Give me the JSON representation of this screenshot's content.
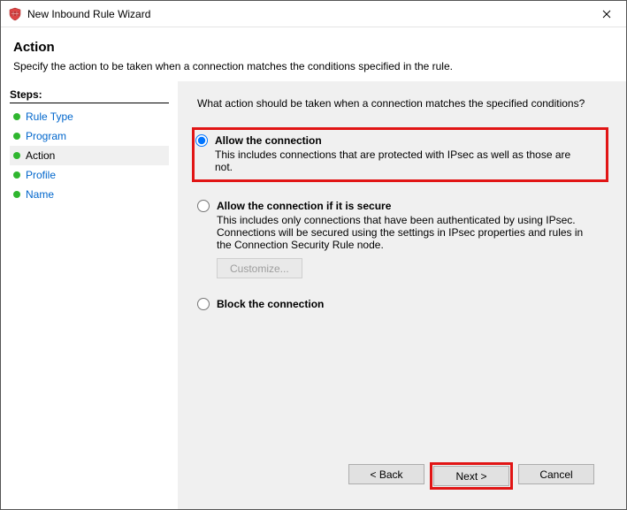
{
  "titlebar": {
    "title": "New Inbound Rule Wizard"
  },
  "header": {
    "title": "Action",
    "description": "Specify the action to be taken when a connection matches the conditions specified in the rule."
  },
  "sidebar": {
    "heading": "Steps:",
    "items": [
      {
        "label": "Rule Type"
      },
      {
        "label": "Program"
      },
      {
        "label": "Action"
      },
      {
        "label": "Profile"
      },
      {
        "label": "Name"
      }
    ],
    "active_index": 2
  },
  "content": {
    "question": "What action should be taken when a connection matches the specified conditions?",
    "options": [
      {
        "id": "allow",
        "label": "Allow the connection",
        "description": "This includes connections that are protected with IPsec as well as those are not.",
        "selected": true,
        "highlighted": true
      },
      {
        "id": "allow-secure",
        "label": "Allow the connection if it is secure",
        "description": "This includes only connections that have been authenticated by using IPsec.  Connections will be secured using the settings in IPsec properties and rules in the Connection Security Rule node.",
        "selected": false,
        "customize_label": "Customize...",
        "customize_enabled": false
      },
      {
        "id": "block",
        "label": "Block the connection",
        "selected": false
      }
    ]
  },
  "footer": {
    "back": "< Back",
    "next": "Next >",
    "cancel": "Cancel",
    "next_highlighted": true
  }
}
